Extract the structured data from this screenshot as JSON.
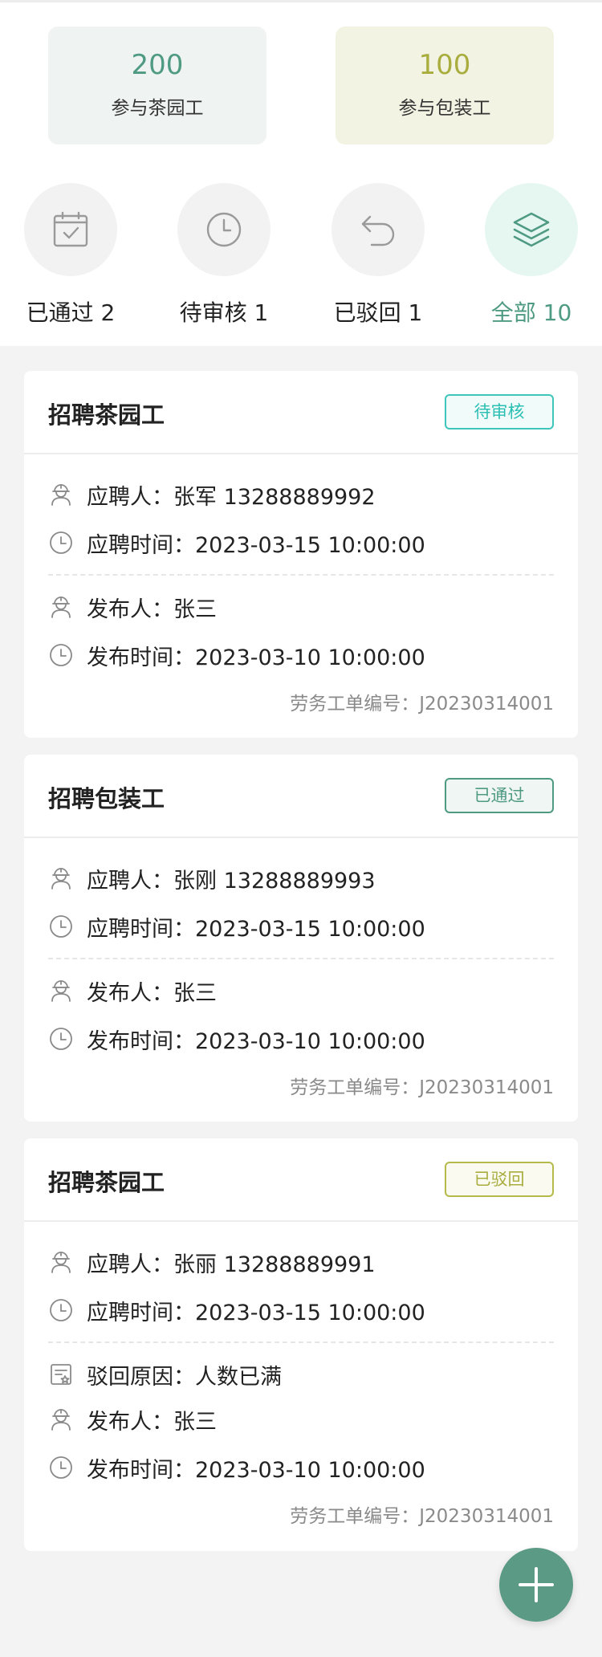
{
  "stats": {
    "tea": {
      "value": "200",
      "label": "参与茶园工"
    },
    "pack": {
      "value": "100",
      "label": "参与包装工"
    }
  },
  "filters": [
    {
      "label": "已通过 2",
      "icon": "calendar-check-icon"
    },
    {
      "label": "待审核 1",
      "icon": "clock-icon"
    },
    {
      "label": "已驳回 1",
      "icon": "undo-icon"
    },
    {
      "label": "全部 10",
      "icon": "layers-icon"
    }
  ],
  "colors": {
    "accent": "#4e9a82",
    "pending": "#2bbfb4",
    "rejected": "#a8ad3e"
  },
  "cards": [
    {
      "title": "招聘茶园工",
      "status": "待审核",
      "applicant": "应聘人：张军 13288889992",
      "apply_time": "应聘时间：2023-03-15   10:00:00",
      "publisher": "发布人：张三",
      "publish_time": "发布时间：2023-03-10   10:00:00",
      "order_no": "劳务工单编号：J20230314001"
    },
    {
      "title": "招聘包装工",
      "status": "已通过",
      "applicant": "应聘人：张刚 13288889993",
      "apply_time": "应聘时间：2023-03-15   10:00:00",
      "publisher": "发布人：张三",
      "publish_time": "发布时间：2023-03-10   10:00:00",
      "order_no": "劳务工单编号：J20230314001"
    },
    {
      "title": "招聘茶园工",
      "status": "已驳回",
      "applicant": "应聘人：张丽 13288889991",
      "apply_time": "应聘时间：2023-03-15   10:00:00",
      "reject_reason": "驳回原因：人数已满",
      "publisher": "发布人：张三",
      "publish_time": "发布时间：2023-03-10   10:00:00",
      "order_no": "劳务工单编号：J20230314001"
    }
  ]
}
